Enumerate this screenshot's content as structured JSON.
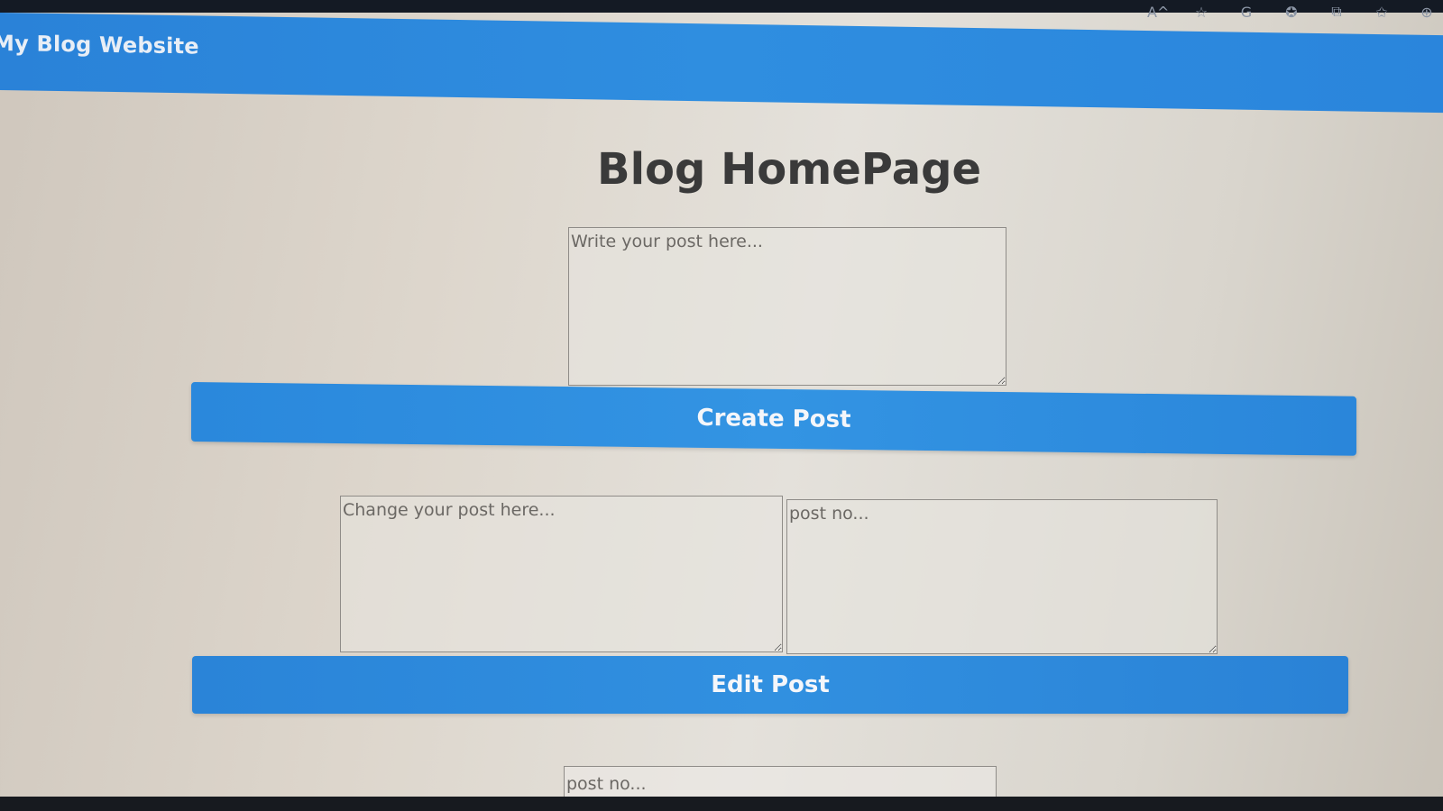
{
  "browser_icons": [
    "A^",
    "☆",
    "G",
    "✪",
    "⧉",
    "✩",
    "⊕"
  ],
  "navbar": {
    "brand": "My Blog Website"
  },
  "main": {
    "title": "Blog HomePage",
    "post_input": {
      "placeholder": "Write your post here...",
      "value": ""
    },
    "create_button": "Create Post",
    "edit_section": {
      "change_input_placeholder": "Change your post here...",
      "post_no_placeholder": "post no..."
    },
    "edit_button": "Edit Post",
    "delete_section": {
      "post_no_placeholder": "post no..."
    }
  },
  "colors": {
    "navbar": "#2f8ee0",
    "button": "#3394e3",
    "title_text": "#3a3a3a"
  }
}
